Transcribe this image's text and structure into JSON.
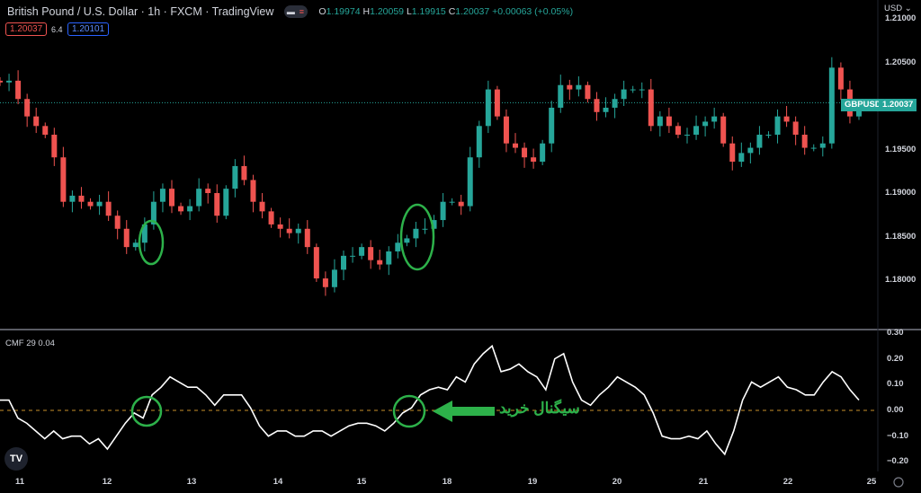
{
  "header": {
    "symbol_title": "British Pound / U.S. Dollar · 1h · FXCM · TradingView",
    "open_label": "O",
    "open": "1.19974",
    "high_label": "H",
    "high": "1.20059",
    "low_label": "L",
    "low": "1.19915",
    "close_label": "C",
    "close": "1.20037",
    "change": "+0.00063 (+0.05%)",
    "sell_price": "1.20037",
    "spread": "6.4",
    "buy_price": "1.20101"
  },
  "axis": {
    "currency": "USD ⌄",
    "price_ticks": [
      "1.21000",
      "1.20500",
      "1.19500",
      "1.19000",
      "1.18500",
      "1.18000"
    ],
    "cmf_ticks": [
      "0.30",
      "0.20",
      "0.10",
      "0.00",
      "−0.10",
      "−0.20"
    ],
    "time_ticks": [
      "11",
      "12",
      "13",
      "14",
      "15",
      "18",
      "19",
      "20",
      "21",
      "22",
      "25"
    ]
  },
  "price_tag": {
    "symbol": "GBPUSD",
    "value": "1.20037"
  },
  "indicator": {
    "label": "CMF 29  0.04"
  },
  "annotation": {
    "text": "سیگنال خرید"
  },
  "logo": "TV",
  "colors": {
    "up": "#26a69a",
    "down": "#ef5350",
    "annotation": "#2db14a",
    "zero_line": "#c8902a"
  },
  "chart_data": [
    {
      "type": "candlestick",
      "title": "GBPUSD 1h",
      "ylim": [
        1.175,
        1.211
      ],
      "closes": [
        1.2027,
        1.2029,
        1.2008,
        1.1988,
        1.1977,
        1.1967,
        1.1941,
        1.189,
        1.1897,
        1.189,
        1.1885,
        1.189,
        1.1874,
        1.1859,
        1.1838,
        1.1843,
        1.1864,
        1.189,
        1.1905,
        1.1885,
        1.1879,
        1.1885,
        1.1905,
        1.19,
        1.1874,
        1.1905,
        1.1931,
        1.1915,
        1.189,
        1.1879,
        1.1864,
        1.1859,
        1.1854,
        1.1859,
        1.1838,
        1.1802,
        1.1792,
        1.1812,
        1.1828,
        1.1828,
        1.1838,
        1.1823,
        1.1818,
        1.1833,
        1.1843,
        1.1848,
        1.1859,
        1.1859,
        1.1869,
        1.189,
        1.189,
        1.1885,
        1.1941,
        1.1977,
        1.2019,
        1.1988,
        1.1957,
        1.1952,
        1.1941,
        1.1936,
        1.1957,
        1.1998,
        1.2024,
        1.2019,
        1.2024,
        1.2008,
        1.1993,
        1.1998,
        1.2008,
        1.2019,
        1.2019,
        1.2019,
        1.1977,
        1.1988,
        1.1977,
        1.1967,
        1.1967,
        1.1977,
        1.1982,
        1.1988,
        1.1957,
        1.1936,
        1.1946,
        1.1952,
        1.1967,
        1.1967,
        1.1988,
        1.1982,
        1.1967,
        1.1952,
        1.1952,
        1.1957,
        1.2044,
        1.2019,
        1.1988,
        1.2004
      ],
      "last_price": 1.20037
    },
    {
      "type": "line",
      "title": "CMF 29",
      "ylim": [
        -0.24,
        0.31
      ],
      "zero_line": 0,
      "values": [
        0.04,
        0.04,
        -0.03,
        -0.05,
        -0.08,
        -0.11,
        -0.08,
        -0.11,
        -0.1,
        -0.1,
        -0.13,
        -0.11,
        -0.15,
        -0.1,
        -0.05,
        -0.01,
        -0.03,
        0.06,
        0.09,
        0.13,
        0.11,
        0.09,
        0.09,
        0.06,
        0.02,
        0.06,
        0.06,
        0.06,
        0.01,
        -0.06,
        -0.1,
        -0.08,
        -0.08,
        -0.1,
        -0.1,
        -0.08,
        -0.08,
        -0.1,
        -0.08,
        -0.06,
        -0.05,
        -0.05,
        -0.06,
        -0.08,
        -0.05,
        -0.01,
        0.01,
        0.06,
        0.08,
        0.09,
        0.08,
        0.13,
        0.11,
        0.18,
        0.22,
        0.25,
        0.15,
        0.16,
        0.18,
        0.15,
        0.13,
        0.08,
        0.2,
        0.22,
        0.11,
        0.04,
        0.02,
        0.06,
        0.09,
        0.13,
        0.11,
        0.09,
        0.06,
        -0.01,
        -0.1,
        -0.11,
        -0.11,
        -0.1,
        -0.11,
        -0.08,
        -0.13,
        -0.17,
        -0.08,
        0.04,
        0.11,
        0.09,
        0.11,
        0.13,
        0.09,
        0.08,
        0.06,
        0.06,
        0.11,
        0.15,
        0.13,
        0.08,
        0.04
      ]
    }
  ]
}
